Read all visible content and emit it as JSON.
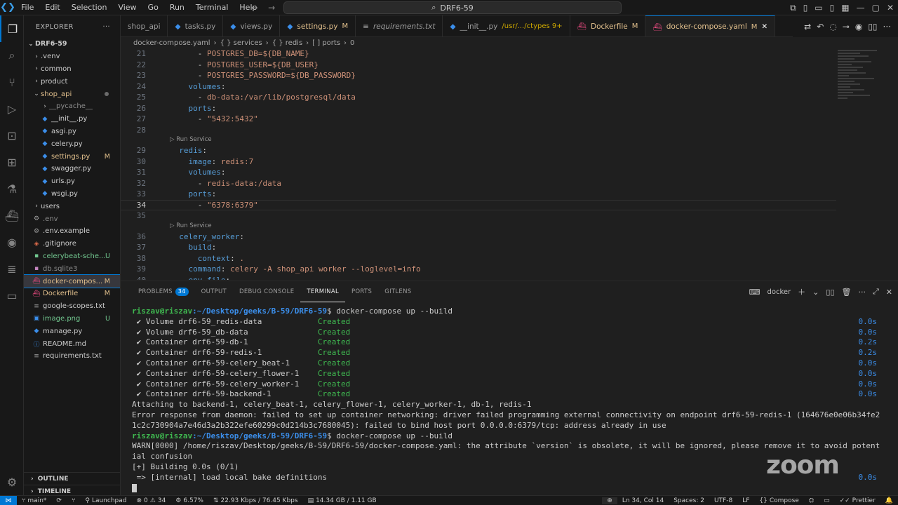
{
  "menu": [
    "File",
    "Edit",
    "Selection",
    "View",
    "Go",
    "Run",
    "Terminal",
    "Help"
  ],
  "command_center": "DRF6-59",
  "explorer": {
    "title": "EXPLORER",
    "root": "DRF6-59",
    "items": [
      {
        "label": ".venv",
        "type": "folder",
        "color": "#cccccc",
        "badge": ""
      },
      {
        "label": "common",
        "type": "folder",
        "color": "#cccccc",
        "badge": ""
      },
      {
        "label": "product",
        "type": "folder",
        "color": "#cccccc",
        "badge": ""
      },
      {
        "label": "shop_api",
        "type": "folder-open",
        "color": "#e2c08d",
        "badge": ""
      },
      {
        "label": "__pycache__",
        "type": "folder",
        "color": "#8c8c8c",
        "badge": ""
      },
      {
        "label": "__init__.py",
        "type": "py",
        "color": "#cccccc",
        "badge": ""
      },
      {
        "label": "asgi.py",
        "type": "py",
        "color": "#cccccc",
        "badge": ""
      },
      {
        "label": "celery.py",
        "type": "py",
        "color": "#cccccc",
        "badge": ""
      },
      {
        "label": "settings.py",
        "type": "py",
        "color": "#e2c08d",
        "badge": "M"
      },
      {
        "label": "swagger.py",
        "type": "py",
        "color": "#cccccc",
        "badge": ""
      },
      {
        "label": "urls.py",
        "type": "py",
        "color": "#cccccc",
        "badge": ""
      },
      {
        "label": "wsgi.py",
        "type": "py",
        "color": "#cccccc",
        "badge": ""
      },
      {
        "label": "users",
        "type": "folder",
        "color": "#cccccc",
        "badge": ""
      },
      {
        "label": ".env",
        "type": "gear",
        "color": "#8c8c8c",
        "badge": ""
      },
      {
        "label": ".env.example",
        "type": "gear",
        "color": "#cccccc",
        "badge": ""
      },
      {
        "label": ".gitignore",
        "type": "git",
        "color": "#cccccc",
        "badge": ""
      },
      {
        "label": "celerybeat-sche...",
        "type": "file",
        "color": "#73c991",
        "badge": "U"
      },
      {
        "label": "db.sqlite3",
        "type": "db",
        "color": "#8c8c8c",
        "badge": ""
      },
      {
        "label": "docker-compos...",
        "type": "docker",
        "color": "#e2c08d",
        "badge": "M"
      },
      {
        "label": "Dockerfile",
        "type": "docker",
        "color": "#e2c08d",
        "badge": "M"
      },
      {
        "label": "google-scopes.txt",
        "type": "txt",
        "color": "#cccccc",
        "badge": ""
      },
      {
        "label": "image.png",
        "type": "img",
        "color": "#73c991",
        "badge": "U"
      },
      {
        "label": "manage.py",
        "type": "py",
        "color": "#cccccc",
        "badge": ""
      },
      {
        "label": "README.md",
        "type": "md",
        "color": "#cccccc",
        "badge": ""
      },
      {
        "label": "requirements.txt",
        "type": "txt",
        "color": "#cccccc",
        "badge": ""
      }
    ],
    "outline": "OUTLINE",
    "timeline": "TIMELINE"
  },
  "tabs": [
    {
      "label": "shop_api",
      "mod": "",
      "active": false
    },
    {
      "label": "tasks.py",
      "mod": "",
      "active": false
    },
    {
      "label": "views.py",
      "mod": "",
      "active": false
    },
    {
      "label": "settings.py",
      "mod": "M",
      "active": false
    },
    {
      "label": "requirements.txt",
      "mod": "",
      "active": false
    },
    {
      "label": "__init__.py",
      "mod": "/usr/.../ctypes 9+",
      "active": false
    },
    {
      "label": "Dockerfile",
      "mod": "M",
      "active": false
    },
    {
      "label": "docker-compose.yaml",
      "mod": "M",
      "active": true
    }
  ],
  "breadcrumb": [
    "docker-compose.yaml",
    "{ } services",
    "{ } redis",
    "[ ] ports",
    "0"
  ],
  "code": {
    "current_line": 34,
    "codelens": "Run Service",
    "lines": [
      {
        "n": 21,
        "html": "      - <span class=\"s\">POSTGRES_DB=${DB_NAME}</span>"
      },
      {
        "n": 22,
        "html": "      - <span class=\"s\">POSTGRES_USER=${DB_USER}</span>"
      },
      {
        "n": 23,
        "html": "      - <span class=\"s\">POSTGRES_PASSWORD=${DB_PASSWORD}</span>"
      },
      {
        "n": 24,
        "html": "    <span class=\"k\">volumes</span>:"
      },
      {
        "n": 25,
        "html": "      - <span class=\"s\">db-data:/var/lib/postgresql/data</span>"
      },
      {
        "n": 26,
        "html": "    <span class=\"k\">ports</span>:"
      },
      {
        "n": 27,
        "html": "      - <span class=\"s\">\"5432:5432\"</span>"
      },
      {
        "n": 28,
        "html": ""
      },
      {
        "n": 29,
        "html": "  <span class=\"k\">redis</span>:"
      },
      {
        "n": 30,
        "html": "    <span class=\"k\">image</span>: <span class=\"s\">redis:7</span>"
      },
      {
        "n": 31,
        "html": "    <span class=\"k\">volumes</span>:"
      },
      {
        "n": 32,
        "html": "      - <span class=\"s\">redis-data:/data</span>"
      },
      {
        "n": 33,
        "html": "    <span class=\"k\">ports</span>:"
      },
      {
        "n": 34,
        "html": "      - <span class=\"s\">\"6378:6379\"</span>"
      },
      {
        "n": 35,
        "html": ""
      },
      {
        "n": 36,
        "html": "  <span class=\"k\">celery_worker</span>:"
      },
      {
        "n": 37,
        "html": "    <span class=\"k\">build</span>:"
      },
      {
        "n": 38,
        "html": "      <span class=\"k\">context</span>: <span class=\"s\">.</span>"
      },
      {
        "n": 39,
        "html": "    <span class=\"k\">command</span>: <span class=\"s\">celery -A shop_api worker --loglevel=info</span>"
      },
      {
        "n": 40,
        "html": "    <span class=\"k\">env_file</span>:"
      }
    ]
  },
  "panel": {
    "tabs": [
      {
        "label": "PROBLEMS",
        "badge": "34",
        "active": false
      },
      {
        "label": "OUTPUT",
        "badge": "",
        "active": false
      },
      {
        "label": "DEBUG CONSOLE",
        "badge": "",
        "active": false
      },
      {
        "label": "TERMINAL",
        "badge": "",
        "active": true
      },
      {
        "label": "PORTS",
        "badge": "",
        "active": false
      },
      {
        "label": "GITLENS",
        "badge": "",
        "active": false
      }
    ],
    "terminal_name": "docker"
  },
  "terminal": {
    "prompt_user": "riszav@riszav",
    "prompt_path": ":~/Desktop/geeks/B-59/DRF6-59",
    "command1": "$ docker-compose up --build",
    "created": [
      {
        "name": " ✔ Volume drf6-59_redis-data        ",
        "status": "Created",
        "time": "0.0s"
      },
      {
        "name": " ✔ Volume drf6-59_db-data           ",
        "status": "Created",
        "time": "0.0s"
      },
      {
        "name": " ✔ Container drf6-59-db-1           ",
        "status": "Created",
        "time": "0.2s"
      },
      {
        "name": " ✔ Container drf6-59-redis-1        ",
        "status": "Created",
        "time": "0.2s"
      },
      {
        "name": " ✔ Container drf6-59-celery_beat-1  ",
        "status": "Created",
        "time": "0.0s"
      },
      {
        "name": " ✔ Container drf6-59-celery_flower-1",
        "status": "Created",
        "time": "0.0s"
      },
      {
        "name": " ✔ Container drf6-59-celery_worker-1",
        "status": "Created",
        "time": "0.0s"
      },
      {
        "name": " ✔ Container drf6-59-backend-1      ",
        "status": "Created",
        "time": "0.0s"
      }
    ],
    "attaching": "Attaching to backend-1, celery_beat-1, celery_flower-1, celery_worker-1, db-1, redis-1",
    "error1": "Error response from daemon: failed to set up container networking: driver failed programming external connectivity on endpoint drf6-59-redis-1 (164676e0e06b34fe2",
    "error2": "1c2c730904a7e46d3a2b322efe60299c0d214b3c7680045): failed to bind host port 0.0.0.0:6379/tcp: address already in use",
    "command2": "$ docker-compose up --build",
    "warn1": "WARN[0000] /home/riszav/Desktop/geeks/B-59/DRF6-59/docker-compose.yaml: the attribute `version` is obsolete, it will be ignored, please remove it to avoid potent",
    "warn2": "ial confusion",
    "building": "[+] Building 0.0s (0/1)",
    "bake": " => [internal] load local bake definitions",
    "bake_time": "0.0s"
  },
  "watermark": "zoom",
  "status": {
    "branch": "main*",
    "launchpad": "Launchpad",
    "errors": "0",
    "warnings": "34",
    "cpu": "6.57%",
    "net": "22.93 Kbps / 76.45 Kbps",
    "mem": "14.34 GB / 1.11 GB",
    "position": "Ln 34, Col 14",
    "spaces": "Spaces: 2",
    "encoding": "UTF-8",
    "eol": "LF",
    "language": "Compose",
    "prettier": "Prettier"
  },
  "colors": {
    "accent": "#0078d4",
    "keyword": "#569cd6",
    "string": "#ce9178",
    "success": "#3fb950",
    "prompt": "#3b8eea"
  }
}
